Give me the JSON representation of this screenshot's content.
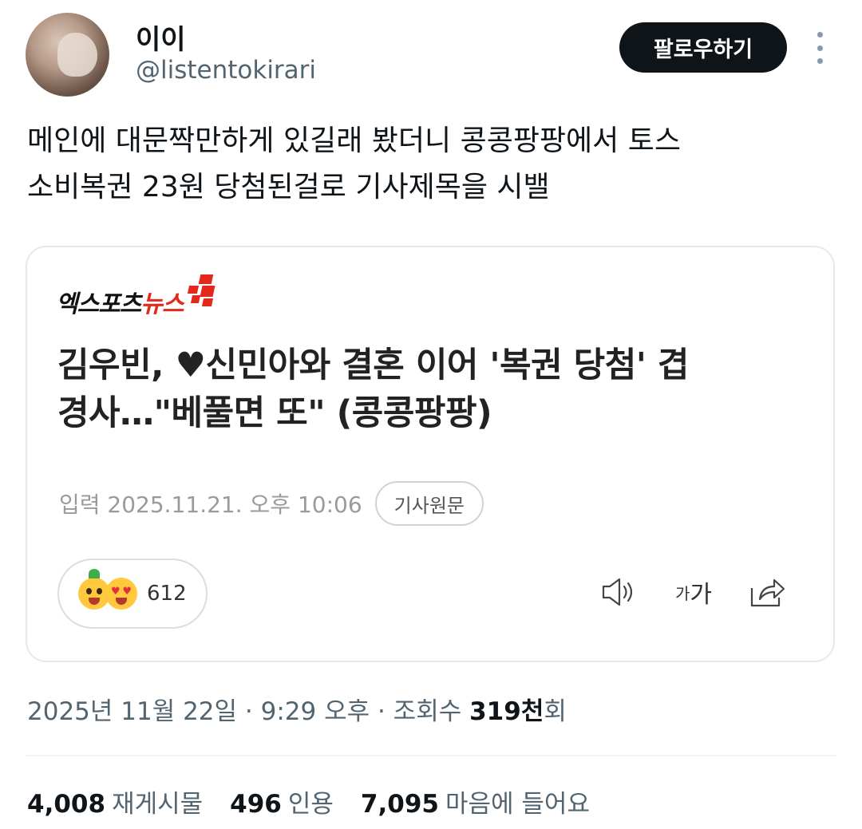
{
  "author": {
    "display_name": "이이",
    "handle": "@listentokirari"
  },
  "follow_label": "팔로우하기",
  "tweet_lines": [
    "메인에 대문짝만하게 있길래 봤더니 콩콩팡팡에서 토스",
    "소비복권 23원 당첨된걸로 기사제목을 시밸"
  ],
  "card": {
    "logo_text": "엑스포츠",
    "logo_accent": "뉴스",
    "headline_lines": [
      "김우빈, ♥신민아와 결혼 이어 '복권 당첨' 겹",
      "경사…\"베풀면 또\" (콩콩팡팡)"
    ],
    "published": "입력 2025.11.21. 오후 10:06",
    "source_label": "기사원문",
    "reaction_count": "612",
    "font_tool_small": "가",
    "font_tool_large": "가",
    "accent_color": "#e2291b"
  },
  "timestamp": {
    "prefix": "2025년 11월 22일 · 9:29 오후 · 조회수 ",
    "views": "319천",
    "suffix": "회"
  },
  "stats": [
    {
      "value": "4,008",
      "label": "재게시물"
    },
    {
      "value": "496",
      "label": "인용"
    },
    {
      "value": "7,095",
      "label": "마음에 들어요"
    }
  ],
  "icons": [
    "more-vert-icon",
    "speaker-icon",
    "font-size-icon",
    "share-icon",
    "reaction-emoji-icon"
  ]
}
